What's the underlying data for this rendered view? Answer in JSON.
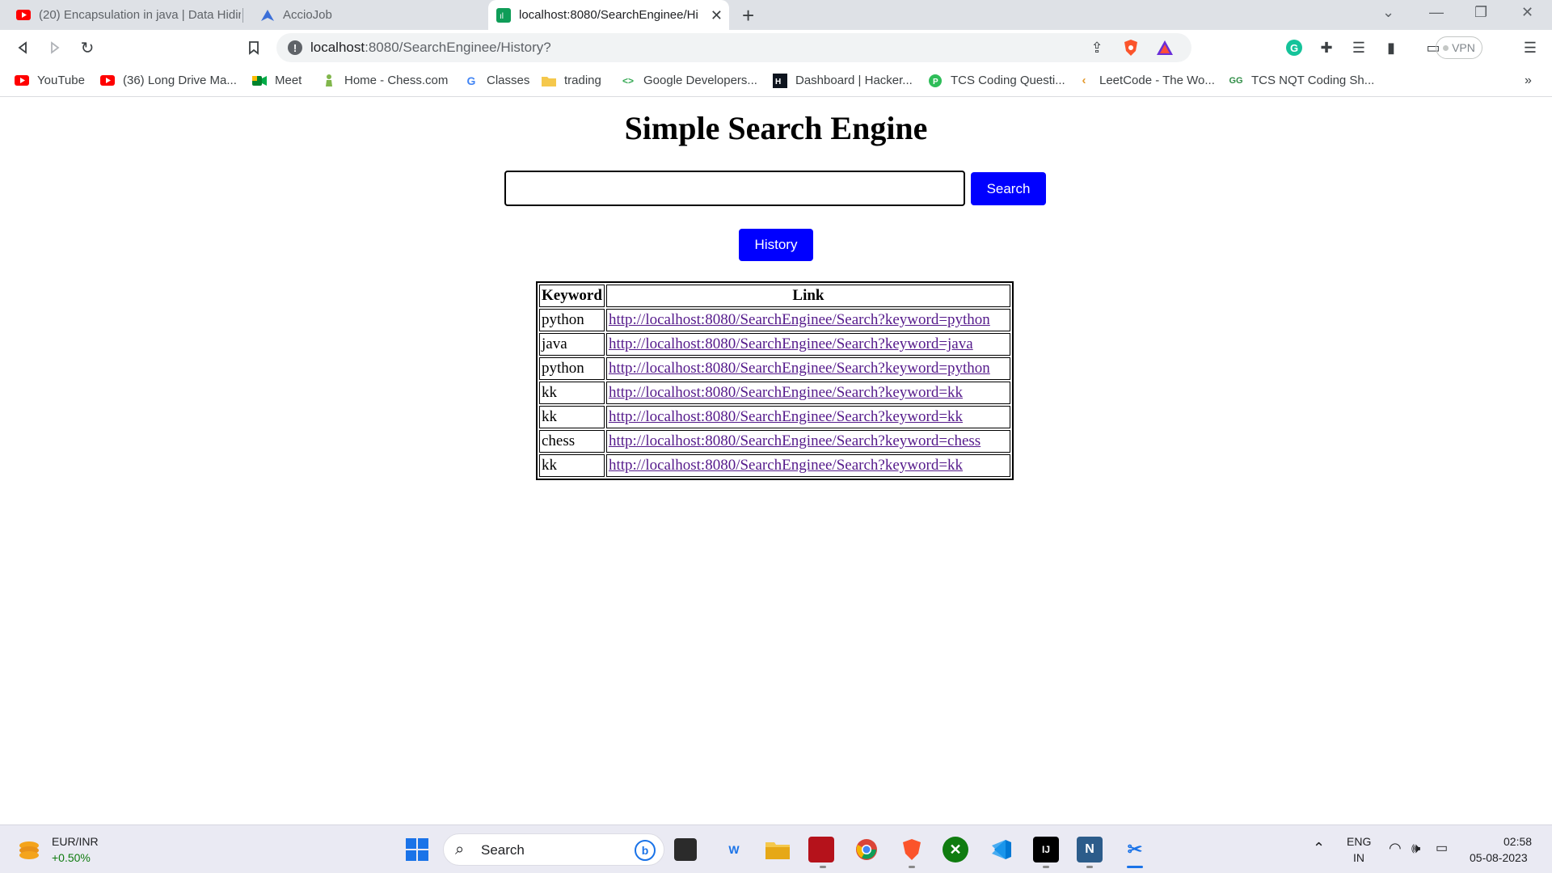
{
  "browser": {
    "tabs": [
      {
        "title": "(20) Encapsulation in java | Data Hidin",
        "icon": "youtube-icon"
      },
      {
        "title": "AccioJob",
        "icon": "acciojob-icon"
      },
      {
        "title": "localhost:8080/SearchEnginee/Hi",
        "icon": "app-icon",
        "active": true
      }
    ],
    "address": {
      "host": "localhost",
      "path": ":8080/SearchEnginee/History?"
    },
    "vpn_label": "VPN",
    "bookmarks": [
      {
        "label": "YouTube",
        "icon": "youtube-icon"
      },
      {
        "label": "(36) Long Drive Ma...",
        "icon": "youtube-icon"
      },
      {
        "label": "Meet",
        "icon": "meet-icon"
      },
      {
        "label": "Home - Chess.com",
        "icon": "chess-icon"
      },
      {
        "label": "Classes",
        "icon": "google-icon"
      },
      {
        "label": "trading",
        "icon": "folder-icon"
      },
      {
        "label": "Google Developers...",
        "icon": "developers-icon"
      },
      {
        "label": "Dashboard | Hacker...",
        "icon": "hackerrank-icon"
      },
      {
        "label": "TCS Coding Questi...",
        "icon": "tcs-icon"
      },
      {
        "label": "LeetCode - The Wo...",
        "icon": "leetcode-icon"
      },
      {
        "label": "TCS NQT Coding Sh...",
        "icon": "gfg-icon"
      }
    ],
    "more_bookmarks": "»"
  },
  "page": {
    "title": "Simple Search Engine",
    "search_value": "",
    "search_button": "Search",
    "history_button": "History",
    "table": {
      "headers": [
        "Keyword",
        "Link"
      ],
      "rows": [
        {
          "keyword": "python",
          "link": "http://localhost:8080/SearchEnginee/Search?keyword=python"
        },
        {
          "keyword": "java",
          "link": "http://localhost:8080/SearchEnginee/Search?keyword=java"
        },
        {
          "keyword": "python",
          "link": "http://localhost:8080/SearchEnginee/Search?keyword=python"
        },
        {
          "keyword": "kk",
          "link": "http://localhost:8080/SearchEnginee/Search?keyword=kk"
        },
        {
          "keyword": "kk",
          "link": "http://localhost:8080/SearchEnginee/Search?keyword=kk"
        },
        {
          "keyword": "chess",
          "link": "http://localhost:8080/SearchEnginee/Search?keyword=chess"
        },
        {
          "keyword": "kk",
          "link": "http://localhost:8080/SearchEnginee/Search?keyword=kk"
        }
      ]
    }
  },
  "taskbar": {
    "widget": {
      "pair": "EUR/INR",
      "change": "+0.50%"
    },
    "search_label": "Search",
    "lang": {
      "line1": "ENG",
      "line2": "IN"
    },
    "time": "02:58",
    "date": "05-08-2023"
  }
}
